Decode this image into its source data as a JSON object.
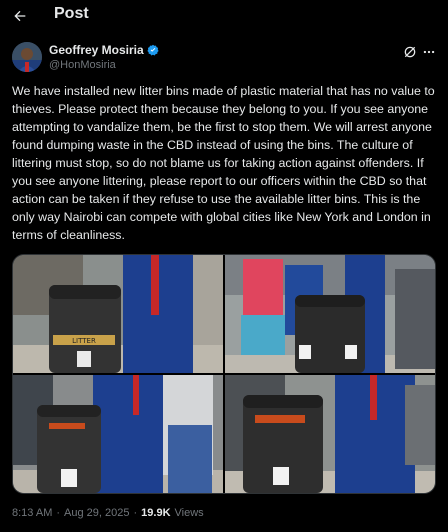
{
  "header": {
    "title": "Post"
  },
  "author": {
    "name": "Geoffrey Mosiria",
    "handle": "@HonMosiria"
  },
  "tweet": {
    "text": "We have installed new litter bins made of plastic material that has no value to thieves. Please protect them because they belong to you. If you see anyone attempting to vandalize them, be the first to stop them. We will arrest anyone found dumping waste in the CBD instead of using the bins. The culture of littering must stop, so do not blame us for taking action against offenders. If you see anyone littering, please report to our officers within the CBD so that action can be taken if they refuse to use the available litter bins. This is the only way Nairobi can compete with global cities like New York and London in terms of cleanliness."
  },
  "photos": [
    {
      "bin_label": "LITTER"
    },
    {
      "bin_label": "LITTER"
    },
    {
      "bin_label": "LITTER"
    },
    {
      "bin_label": "LITTER"
    }
  ],
  "meta": {
    "time": "8:13 AM",
    "sep1": "·",
    "date": "Aug 29, 2025",
    "sep2": "·",
    "views_count": "19.9K",
    "views_label": "Views"
  },
  "colors": {
    "background": "#000000",
    "text": "#e7e9ea",
    "muted": "#71767b",
    "verified": "#1d9bf0",
    "border": "#2f3336"
  },
  "icons": [
    "back-arrow-icon",
    "verified-badge-icon",
    "grok-icon",
    "more-options-icon"
  ]
}
